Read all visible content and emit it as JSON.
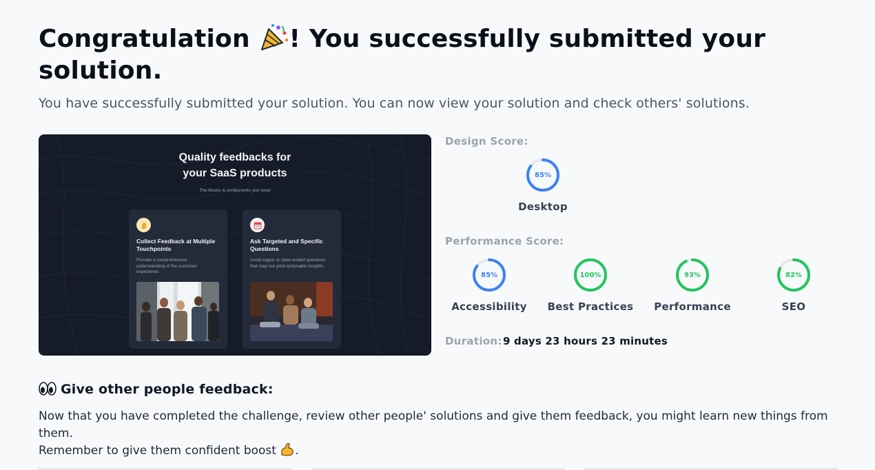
{
  "header": {
    "title_part1": "Congratulation",
    "title_part2": "! You successfully submitted your solution.",
    "subtitle": "You have successfully submitted your solution. You can now view your solution and check others' solutions."
  },
  "preview": {
    "heading_line1": "Quality feedbacks for",
    "heading_line2": "your SaaS products",
    "subheading": "The blocks & components you need",
    "cards": [
      {
        "icon": "hand-icon",
        "title": "Collect Feedback at Multiple Touchpoints",
        "description": "Provide a comprehensive understanding of the customer experience."
      },
      {
        "icon": "calendar-icon",
        "title": "Ask Targeted and Specific Questions",
        "description": "Avoid vague or open-ended questions that may not yield actionable insights."
      }
    ]
  },
  "scores": {
    "design_label": "Design Score:",
    "design": [
      {
        "name": "Desktop",
        "value": 85,
        "display": "85%",
        "color": "#3b82f6"
      }
    ],
    "performance_label": "Performance Score:",
    "performance": [
      {
        "name": "Accessibility",
        "value": 85,
        "display": "85%",
        "color": "#3b82f6"
      },
      {
        "name": "Best Practices",
        "value": 100,
        "display": "100%",
        "color": "#22c55e"
      },
      {
        "name": "Performance",
        "value": 93,
        "display": "93%",
        "color": "#22c55e"
      },
      {
        "name": "SEO",
        "value": 82,
        "display": "82%",
        "color": "#22c55e"
      }
    ],
    "duration_label": "Duration:",
    "duration_value": "9 days 23 hours 23 minutes"
  },
  "feedback": {
    "heading": "Give other people feedback:",
    "line1": "Now that you have completed the challenge, review other people' solutions and give them feedback, you might learn new things from them.",
    "line2_text": "Remember to give them confident boost",
    "line2_end": "."
  },
  "colors": {
    "blue": "#3b82f6",
    "green": "#22c55e",
    "track": "#e5e7eb",
    "preview_bg": "#161b28"
  }
}
